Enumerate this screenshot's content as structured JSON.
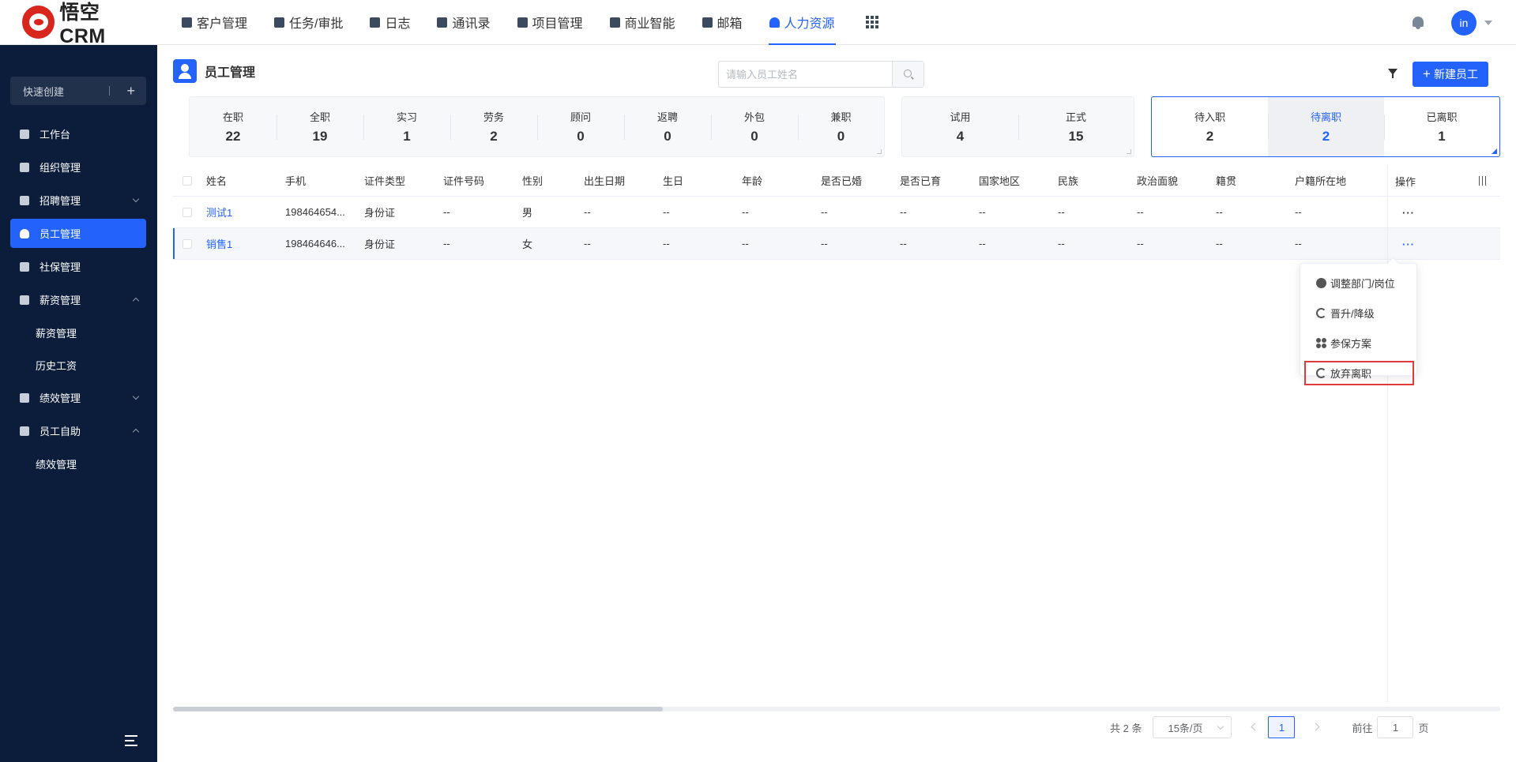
{
  "app": {
    "logo_text": "悟空CRM"
  },
  "nav": {
    "items": [
      {
        "label": "客户管理"
      },
      {
        "label": "任务/审批"
      },
      {
        "label": "日志"
      },
      {
        "label": "通讯录"
      },
      {
        "label": "项目管理"
      },
      {
        "label": "商业智能"
      },
      {
        "label": "邮箱"
      },
      {
        "label": "人力资源",
        "active": true
      }
    ],
    "avatar_text": "in"
  },
  "sidebar": {
    "quick_create": "快速创建",
    "quick_plus": "+",
    "items": [
      {
        "label": "工作台"
      },
      {
        "label": "组织管理"
      },
      {
        "label": "招聘管理"
      },
      {
        "label": "员工管理"
      },
      {
        "label": "社保管理"
      },
      {
        "label": "薪资管理"
      },
      {
        "label": "薪资管理"
      },
      {
        "label": "历史工资"
      },
      {
        "label": "绩效管理"
      },
      {
        "label": "员工自助"
      },
      {
        "label": "绩效管理"
      }
    ]
  },
  "page": {
    "title": "员工管理",
    "search_placeholder": "请输入员工姓名",
    "new_button": "新建员工",
    "new_plus": "+"
  },
  "stats_group1": [
    {
      "label": "在职",
      "value": "22"
    },
    {
      "label": "全职",
      "value": "19"
    },
    {
      "label": "实习",
      "value": "1"
    },
    {
      "label": "劳务",
      "value": "2"
    },
    {
      "label": "顾问",
      "value": "0"
    },
    {
      "label": "返聘",
      "value": "0"
    },
    {
      "label": "外包",
      "value": "0"
    },
    {
      "label": "兼职",
      "value": "0"
    }
  ],
  "stats_group2": [
    {
      "label": "试用",
      "value": "4"
    },
    {
      "label": "正式",
      "value": "15"
    }
  ],
  "stats_group3": [
    {
      "label": "待入职",
      "value": "2"
    },
    {
      "label": "待离职",
      "value": "2",
      "selected": true
    },
    {
      "label": "已离职",
      "value": "1"
    }
  ],
  "table": {
    "headers": [
      "姓名",
      "手机",
      "证件类型",
      "证件号码",
      "性别",
      "出生日期",
      "生日",
      "年龄",
      "是否已婚",
      "是否已育",
      "国家地区",
      "民族",
      "政治面貌",
      "籍贯",
      "户籍所在地",
      "操作"
    ],
    "rows": [
      [
        "测试1",
        "198464654...",
        "身份证",
        "--",
        "男",
        "--",
        "--",
        "--",
        "--",
        "--",
        "--",
        "--",
        "--",
        "--",
        "--"
      ],
      [
        "销售1",
        "198464646...",
        "身份证",
        "--",
        "女",
        "--",
        "--",
        "--",
        "--",
        "--",
        "--",
        "--",
        "--",
        "--",
        "--"
      ]
    ],
    "ops_dots": "···"
  },
  "dropdown": {
    "items": [
      {
        "label": "调整部门/岗位",
        "icon": "user-adjust-icon"
      },
      {
        "label": "晋升/降级",
        "icon": "promote-icon"
      },
      {
        "label": "参保方案",
        "icon": "grid-icon"
      },
      {
        "label": "放弃离职",
        "icon": "refresh-icon"
      }
    ]
  },
  "pager": {
    "total": "共 2 条",
    "page_size": "15条/页",
    "current": "1",
    "goto_label": "前往",
    "goto_value": "1",
    "page_unit": "页"
  }
}
